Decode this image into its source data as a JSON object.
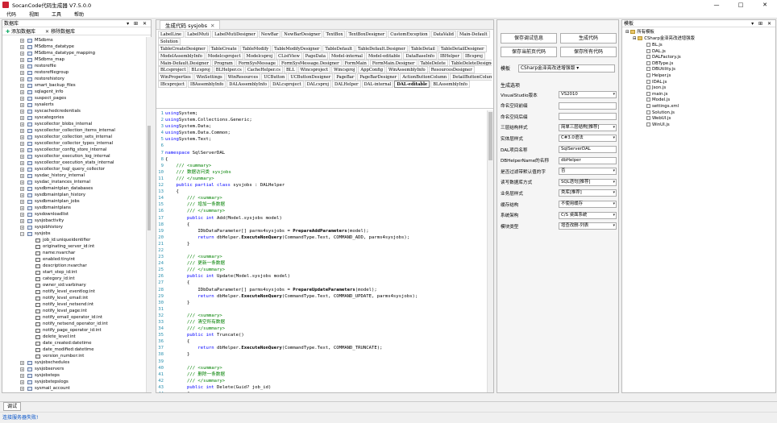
{
  "window": {
    "title": "SocanCode代码生成器 V7.5.0.0",
    "controls": [
      "—",
      "□",
      "✕"
    ]
  },
  "menu": [
    "代码",
    "视图",
    "工具",
    "帮助"
  ],
  "left": {
    "title": "数据库",
    "pin": "▾ ⊞ ✕",
    "add_label": "添加数据库",
    "remove_label": "移除数据库",
    "tables_top": [
      "MSdbms",
      "MSdbms_datatype",
      "MSdbms_datatype_mapping",
      "MSdbms_map",
      "restorefile",
      "restorefilegroup",
      "restorehistory",
      "smart_backup_files",
      "sqlagent_info",
      "suspect_pages",
      "sysalerts",
      "syscachedcredentials",
      "syscategories",
      "syscollector_blobs_internal",
      "syscollector_collection_items_internal",
      "syscollector_collection_sets_internal",
      "syscollector_collector_types_internal",
      "syscollector_config_store_internal",
      "syscollector_execution_log_internal",
      "syscollector_execution_stats_internal",
      "syscollector_tsql_query_collector",
      "sysdac_history_internal",
      "sysdac_instances_internal",
      "sysdbmaintplan_databases",
      "sysdbmaintplan_history",
      "sysdbmaintplan_jobs",
      "sysdbmaintplans",
      "sysdownloadlist",
      "sysjobactivity",
      "sysjobhistory"
    ],
    "expanded_table": "sysjobs",
    "columns": [
      "job_id:uniqueidentifier",
      "originating_server_id:int",
      "name:nvarchar",
      "enabled:tinyint",
      "description:nvarchar",
      "start_step_id:int",
      "category_id:int",
      "owner_sid:varbinary",
      "notify_level_eventlog:int",
      "notify_level_email:int",
      "notify_level_netsend:int",
      "notify_level_page:int",
      "notify_email_operator_id:int",
      "notify_netsend_operator_id:int",
      "notify_page_operator_id:int",
      "delete_level:int",
      "date_created:datetime",
      "date_modified:datetime",
      "version_number:int"
    ],
    "tables_bottom": [
      "sysjobschedules",
      "sysjobservers",
      "sysjobsteps",
      "sysjobstepslogs",
      "sysmail_account"
    ]
  },
  "center": {
    "doc_tab": "生成代码 sysjobs",
    "doc_tab_close": "✕",
    "template_rows": [
      [
        "LabelLine",
        "LabelMuti",
        "LabelMutiDesigner",
        "NewBar",
        "NewBarDesigner",
        "TextBox",
        "TextBoxDesigner",
        "CustomException",
        "DataValid",
        "Main-Default"
      ],
      [
        "Solution"
      ],
      [
        "TableCreateDesigner",
        "TableCreate",
        "TableModify",
        "TableModifyDesigner",
        "TableDefault",
        "TableDefault.Designer",
        "TableDetail",
        "TableDetailDesigner"
      ],
      [
        "ModelAssemblyInfo",
        "Modelcsproject",
        "Modelcsproj",
        "CListView",
        "PageData",
        "Model-internal",
        "Model-editable",
        "DataBaseInfo",
        "IBHelper",
        "IBcsproj"
      ],
      [
        "Main-Default.Designer",
        "Program",
        "FormSysMessage",
        "FormSysMessage.Designer",
        "FormMain",
        "FormMain.Designer",
        "TableDelete",
        "TableDeleteDesigner"
      ],
      [
        "BLcsproject",
        "BLcsproj",
        "BLHelper.cs",
        "CacheHelper.cs",
        "BLL",
        "Wincsproject",
        "Wincsproj",
        "AppConfig",
        "WinAssemblyInfo",
        "ResourcesDesigner"
      ],
      [
        "WinProperties",
        "WinSettings",
        "WinResources",
        "UCButton",
        "UCButtonDesigner",
        "PageBar",
        "PageBarDesigner",
        "ActionButtonColumn",
        "DetailButtonColumn"
      ],
      [
        "IBcsproject",
        "IBAssemblyInfo",
        "DALAssemblyInfo",
        "DALcsproject",
        "DALcsproj",
        "DALHelper",
        "DAL-internal",
        "DAL-editable",
        "BLAssemblyInfo"
      ]
    ],
    "active_template": "DAL-editable",
    "code_lines": [
      [
        [
          "kw",
          "using"
        ],
        [
          "",
          "System;"
        ]
      ],
      [
        [
          "kw",
          "using"
        ],
        [
          "",
          "System.Collections.Generic;"
        ]
      ],
      [
        [
          "kw",
          "using"
        ],
        [
          "",
          "System.Data;"
        ]
      ],
      [
        [
          "kw",
          "using"
        ],
        [
          "",
          "System.Data.Common;"
        ]
      ],
      [
        [
          "kw",
          "using"
        ],
        [
          "",
          "System.Text;"
        ]
      ],
      [],
      [
        [
          "kw",
          "namespace"
        ],
        [
          "",
          " SqlServerDAL"
        ]
      ],
      [
        [
          "",
          "{"
        ]
      ],
      [
        [
          "",
          "    "
        ],
        [
          "cm",
          "/// <summary>"
        ]
      ],
      [
        [
          "",
          "    "
        ],
        [
          "cm",
          "/// 数据访问类 sysjobs"
        ]
      ],
      [
        [
          "",
          "    "
        ],
        [
          "cm",
          "/// </summary>"
        ]
      ],
      [
        [
          "",
          "    "
        ],
        [
          "kw",
          "public partial class"
        ],
        [
          "",
          " sysjobs : DALHelper"
        ]
      ],
      [
        [
          "",
          "    {"
        ]
      ],
      [
        [
          "",
          "        "
        ],
        [
          "cm",
          "/// <summary>"
        ]
      ],
      [
        [
          "",
          "        "
        ],
        [
          "cm",
          "/// 增加一条数据"
        ]
      ],
      [
        [
          "",
          "        "
        ],
        [
          "cm",
          "/// </summary>"
        ]
      ],
      [
        [
          "",
          "        "
        ],
        [
          "kw",
          "public int"
        ],
        [
          "",
          " Add(Model.sysjobs model)"
        ]
      ],
      [
        [
          "",
          "        {"
        ]
      ],
      [
        [
          "",
          "            IDbDataParameter[] parms4sysjobs = "
        ],
        [
          "fn",
          "PrepareAddParameters"
        ],
        [
          "",
          "(model);"
        ]
      ],
      [
        [
          "",
          "            "
        ],
        [
          "kw",
          "return"
        ],
        [
          "",
          " dbHelper."
        ],
        [
          "fn",
          "ExecuteNonQuery"
        ],
        [
          "",
          "(CommandType.Text, COMMAND_ADD, parms4sysjobs);"
        ]
      ],
      [
        [
          "",
          "        }"
        ]
      ],
      [],
      [
        [
          "",
          "        "
        ],
        [
          "cm",
          "/// <summary>"
        ]
      ],
      [
        [
          "",
          "        "
        ],
        [
          "cm",
          "/// 更新一条数据"
        ]
      ],
      [
        [
          "",
          "        "
        ],
        [
          "cm",
          "/// </summary>"
        ]
      ],
      [
        [
          "",
          "        "
        ],
        [
          "kw",
          "public int"
        ],
        [
          "",
          " Update(Model.sysjobs model)"
        ]
      ],
      [
        [
          "",
          "        {"
        ]
      ],
      [
        [
          "",
          "            IDbDataParameter[] parms4sysjobs = "
        ],
        [
          "fn",
          "PrepareUpdateParameters"
        ],
        [
          "",
          "(model);"
        ]
      ],
      [
        [
          "",
          "            "
        ],
        [
          "kw",
          "return"
        ],
        [
          "",
          " dbHelper."
        ],
        [
          "fn",
          "ExecuteNonQuery"
        ],
        [
          "",
          "(CommandType.Text, COMMAND_UPDATE, parms4sysjobs);"
        ]
      ],
      [
        [
          "",
          "        }"
        ]
      ],
      [],
      [
        [
          "",
          "        "
        ],
        [
          "cm",
          "/// <summary>"
        ]
      ],
      [
        [
          "",
          "        "
        ],
        [
          "cm",
          "/// 清空所有数据"
        ]
      ],
      [
        [
          "",
          "        "
        ],
        [
          "cm",
          "/// </summary>"
        ]
      ],
      [
        [
          "",
          "        "
        ],
        [
          "kw",
          "public int"
        ],
        [
          "",
          " Truncate()"
        ]
      ],
      [
        [
          "",
          "        {"
        ]
      ],
      [
        [
          "",
          "            "
        ],
        [
          "kw",
          "return"
        ],
        [
          "",
          " dbHelper."
        ],
        [
          "fn",
          "ExecuteNonQuery"
        ],
        [
          "",
          "(CommandType.Text, COMMAND_TRUNCATE);"
        ]
      ],
      [
        [
          "",
          "        }"
        ]
      ],
      [],
      [
        [
          "",
          "        "
        ],
        [
          "cm",
          "/// <summary>"
        ]
      ],
      [
        [
          "",
          "        "
        ],
        [
          "cm",
          "/// 删除一条数据"
        ]
      ],
      [
        [
          "",
          "        "
        ],
        [
          "cm",
          "/// </summary>"
        ]
      ],
      [
        [
          "",
          "        "
        ],
        [
          "kw",
          "public int"
        ],
        [
          "",
          " Delete(Guid? job_id)"
        ]
      ],
      [
        [
          "",
          "        {"
        ]
      ]
    ]
  },
  "settings": {
    "buttons": {
      "save_debug": "保存调试信息",
      "generate": "生成代码",
      "save_current": "保存当前页代码",
      "save_all": "保存所有代码"
    },
    "template_label": "模板",
    "template_value": "CSharp金泽亮改进增强版",
    "section_label": "生成选项",
    "rows": [
      {
        "label": "VisualStudio版本",
        "value": "VS2010",
        "dropdown": true
      },
      {
        "label": "命名空间前缀",
        "value": "",
        "dropdown": false
      },
      {
        "label": "命名空间后缀",
        "value": "",
        "dropdown": false
      },
      {
        "label": "三层结构样式",
        "value": "简单三层结构[推荐]",
        "dropdown": true
      },
      {
        "label": "实体层样式",
        "value": "C#3.0语法",
        "dropdown": true
      },
      {
        "label": "DAL项目名称",
        "value": "SqlServerDAL",
        "dropdown": false
      },
      {
        "label": "DBHelperName的名称",
        "value": "dbHelper",
        "dropdown": false
      },
      {
        "label": "是否过滤带默认值的字",
        "value": "否",
        "dropdown": true
      },
      {
        "label": "读写数据库方式",
        "value": "SQL语句[推荐]",
        "dropdown": true
      },
      {
        "label": "业务层样式",
        "value": "类库[推荐]",
        "dropdown": true
      },
      {
        "label": "缓存结构",
        "value": "不使用缓存",
        "dropdown": true
      },
      {
        "label": "系统架构",
        "value": "C/S 桌面系统",
        "dropdown": true
      },
      {
        "label": "模块类型",
        "value": "增查改删-列表",
        "dropdown": true
      }
    ]
  },
  "right": {
    "title": "模板",
    "pin": "▾ ⊞ ✕",
    "root": "所有模板",
    "template_folder": "CSharp金泽亮改进增强版",
    "files": [
      "BL.js",
      "DAL.js",
      "DALFactory.js",
      "DBType.js",
      "DBUtility.js",
      "Helper.js",
      "IDAL.js",
      "Json.js",
      "main.js",
      "Model.js",
      "settings.xml",
      "Solution.js",
      "WebUI.js",
      "WinUI.js"
    ]
  },
  "bottom": {
    "tab": "调试"
  },
  "status": {
    "text": "连接服务器失败!"
  }
}
